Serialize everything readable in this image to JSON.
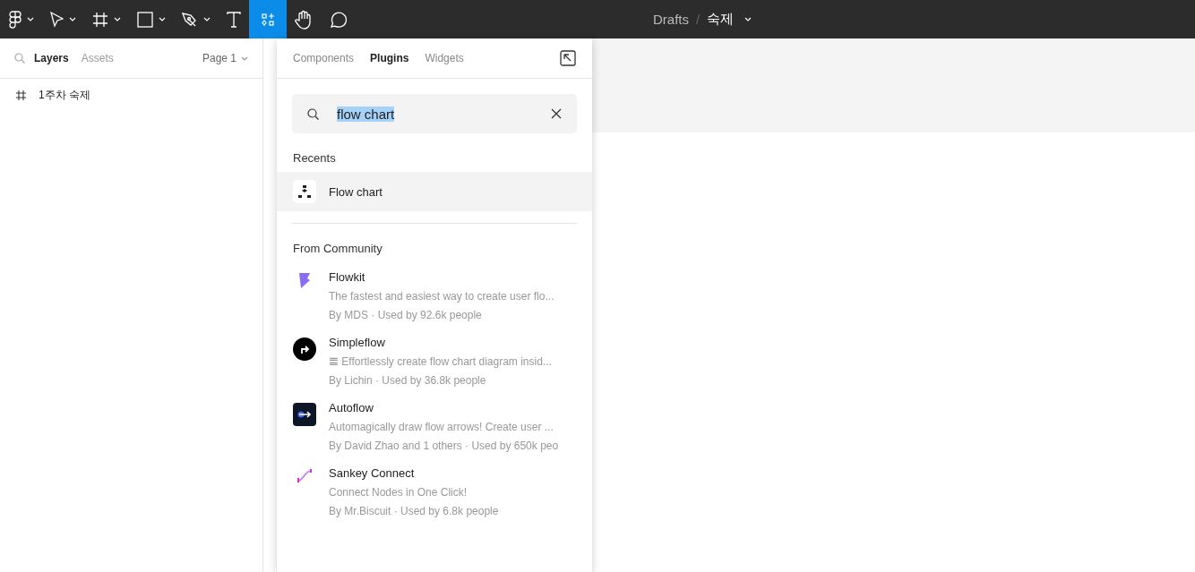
{
  "toolbar": {
    "tools": [
      {
        "kind": "logo",
        "caret": true,
        "selected": false
      },
      {
        "kind": "move",
        "caret": true,
        "selected": false
      },
      {
        "kind": "frame",
        "caret": true,
        "selected": false
      },
      {
        "kind": "rect",
        "caret": true,
        "selected": false
      },
      {
        "kind": "pen",
        "caret": true,
        "selected": false
      },
      {
        "kind": "text",
        "caret": false,
        "selected": false
      },
      {
        "kind": "resources",
        "caret": false,
        "selected": true
      },
      {
        "kind": "hand",
        "caret": false,
        "selected": false
      },
      {
        "kind": "comment",
        "caret": false,
        "selected": false
      }
    ],
    "breadcrumb": {
      "folder": "Drafts",
      "separator": "/",
      "file": "숙제"
    }
  },
  "left_panel": {
    "tabs": [
      {
        "label": "Layers",
        "selected": true
      },
      {
        "label": "Assets",
        "selected": false
      }
    ],
    "page": "Page 1",
    "layers": [
      {
        "name": "1주차 숙제",
        "kind": "frame"
      }
    ]
  },
  "plugins_panel": {
    "tabs": [
      {
        "label": "Components",
        "selected": false
      },
      {
        "label": "Plugins",
        "selected": true
      },
      {
        "label": "Widgets",
        "selected": false
      }
    ],
    "search": {
      "value": "flow chart",
      "text_selected": true
    },
    "recents_heading": "Recents",
    "recents": [
      {
        "name": "Flow chart",
        "kind": "flowchart",
        "hovered": true
      }
    ],
    "community_heading": "From Community",
    "community": [
      {
        "name": "Flowkit",
        "description": "The fastest and easiest way to create user flo...",
        "meta": "By MDS · Used by 92.6k people",
        "kind": "flowkit"
      },
      {
        "name": "Simpleflow",
        "description": "𝌆 Effortlessly create flow chart diagram insid...",
        "meta": "By Lichin · Used by 36.8k people",
        "kind": "simpleflow"
      },
      {
        "name": "Autoflow",
        "description": "Automagically draw flow arrows! Create user ...",
        "meta": "By David Zhao and 1 others · Used by 650k peo",
        "kind": "autoflow"
      },
      {
        "name": "Sankey Connect",
        "description": "Connect Nodes in One Click!",
        "meta": "By Mr.Biscuit · Used by 6.8k people",
        "kind": "sankey"
      }
    ]
  }
}
